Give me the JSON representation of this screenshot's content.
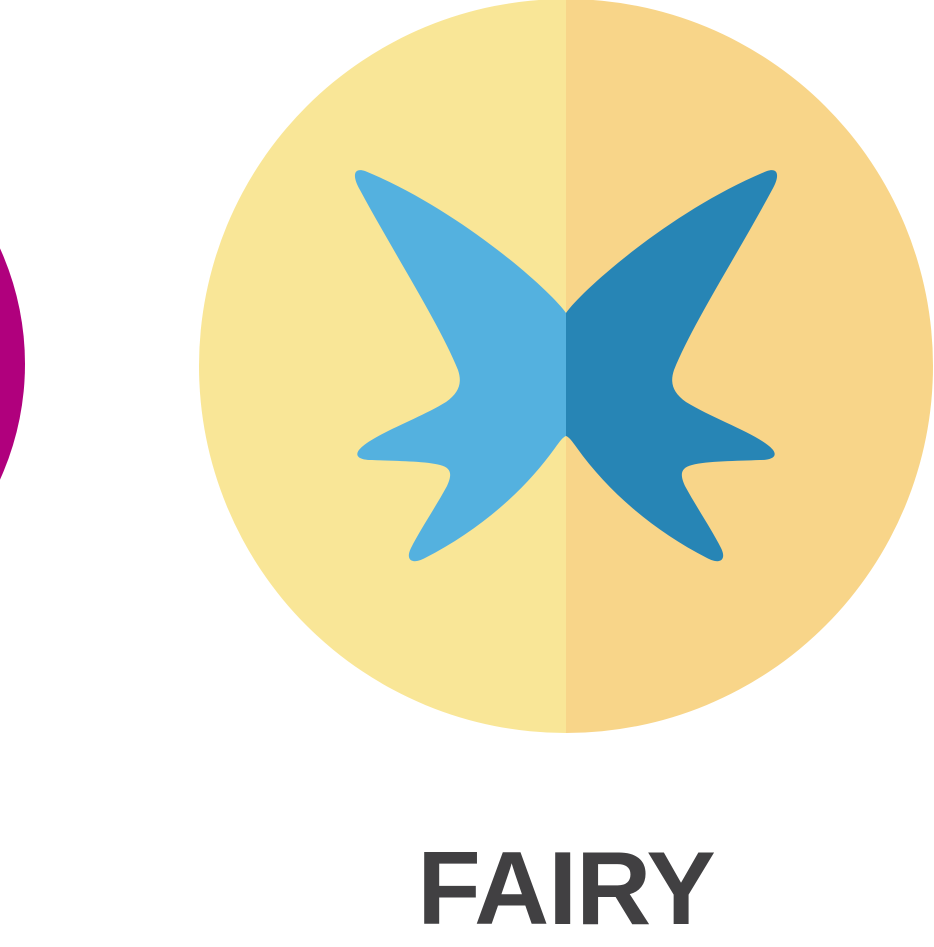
{
  "type_badge": {
    "label": "FAIRY",
    "icon": "butterfly-icon",
    "colors": {
      "circle_left": "#F9E697",
      "circle_right": "#F8D589",
      "wing_left": "#54B1DF",
      "wing_right": "#2785B5",
      "label": "#414042"
    }
  },
  "adjacent_badge": {
    "color": "#B0007D"
  }
}
